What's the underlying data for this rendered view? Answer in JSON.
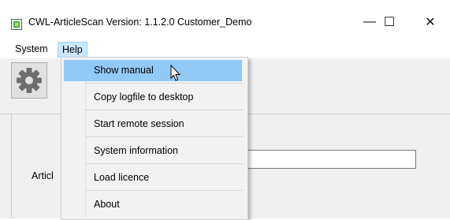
{
  "window": {
    "title": "CWL-ArticleScan  Version: 1.1.2.0  Customer_Demo",
    "minimize_glyph": "—",
    "maximize_glyph": "☐",
    "close_glyph": "✕"
  },
  "menubar": {
    "items": [
      {
        "label": "System"
      },
      {
        "label": "Help"
      }
    ]
  },
  "toolbar": {
    "icon": "gear-icon"
  },
  "content": {
    "article_label": "Articl"
  },
  "help_menu": {
    "items": [
      {
        "label": "Show manual",
        "highlighted": true
      },
      {
        "label": "Copy logfile to desktop"
      },
      {
        "label": "Start remote session"
      },
      {
        "label": "System information"
      },
      {
        "label": "Load licence"
      },
      {
        "label": "About"
      }
    ]
  },
  "colors": {
    "highlight": "#91c9f7",
    "menu_active": "#cce8ff",
    "app_icon_green": "#3a9a3a"
  }
}
